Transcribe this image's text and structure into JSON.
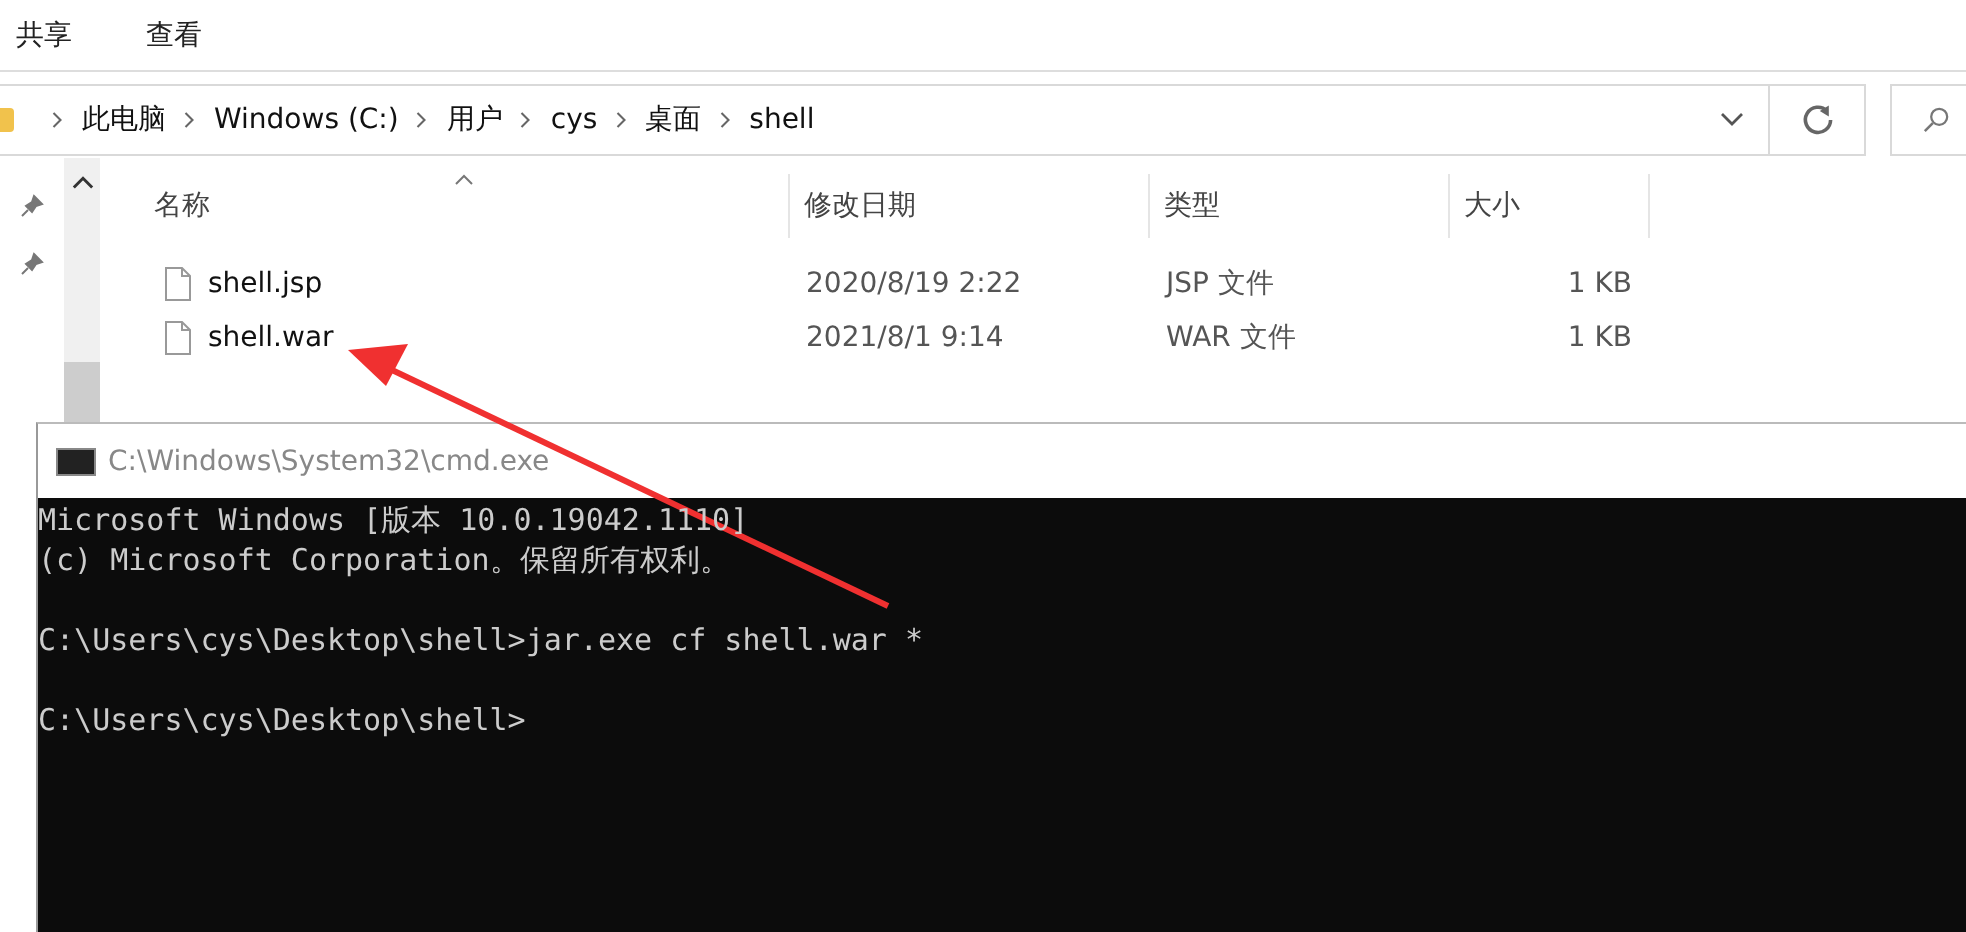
{
  "ribbon_tabs": [
    {
      "label": "共享"
    },
    {
      "label": "查看"
    }
  ],
  "address_bar": {
    "breadcrumbs": [
      "此电脑",
      "Windows (C:)",
      "用户",
      "cys",
      "桌面",
      "shell"
    ]
  },
  "file_list": {
    "columns": [
      {
        "label": "名称",
        "sorted": true
      },
      {
        "label": "修改日期",
        "sorted": false
      },
      {
        "label": "类型",
        "sorted": false
      },
      {
        "label": "大小",
        "sorted": false
      }
    ],
    "rows": [
      {
        "name": "shell.jsp",
        "modified": "2020/8/19 2:22",
        "type": "JSP 文件",
        "size": "1 KB"
      },
      {
        "name": "shell.war",
        "modified": "2021/8/1 9:14",
        "type": "WAR 文件",
        "size": "1 KB"
      }
    ]
  },
  "console": {
    "title": "C:\\Windows\\System32\\cmd.exe",
    "blocks": [
      [
        "Microsoft Windows [版本 10.0.19042.1110]",
        "(c) Microsoft Corporation。保留所有权利。"
      ],
      [
        "C:\\Users\\cys\\Desktop\\shell>jar.exe cf shell.war *"
      ],
      [
        "C:\\Users\\cys\\Desktop\\shell>"
      ]
    ]
  }
}
